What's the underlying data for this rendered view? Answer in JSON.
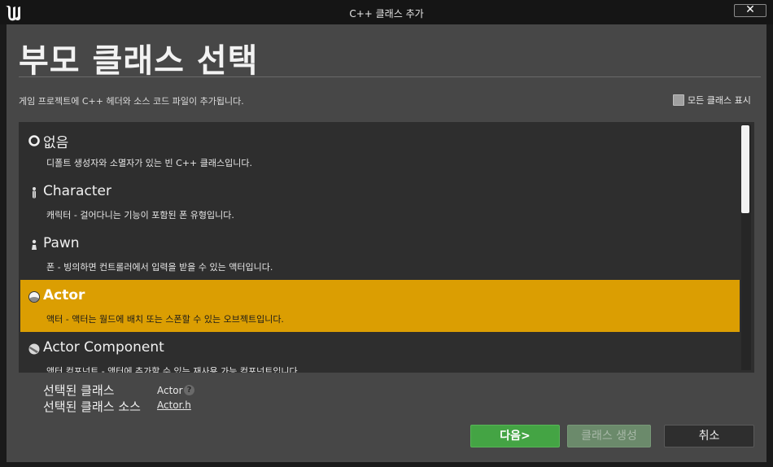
{
  "window": {
    "title": "C++ 클래스 추가",
    "close_label": "✕"
  },
  "header": {
    "title": "부모 클래스 선택",
    "description": "게임 프로젝트에 C++ 헤더와 소스 코드 파일이 추가됩니다."
  },
  "show_all": {
    "label": "모든 클래스 표시",
    "checked": false
  },
  "class_list": {
    "items": [
      {
        "name": "없음",
        "description": "디폴트 생성자와 소멸자가 있는 빈 C++ 클래스입니다.",
        "icon": "circle-outline-icon",
        "selected": false
      },
      {
        "name": "Character",
        "description": "캐릭터 - 걸어다니는 기능이 포함된 폰 유형입니다.",
        "icon": "character-icon",
        "selected": false
      },
      {
        "name": "Pawn",
        "description": "폰 - 빙의하면 컨트롤러에서 입력을 받을 수 있는 액터입니다.",
        "icon": "pawn-icon",
        "selected": false
      },
      {
        "name": "Actor",
        "description": "액터 - 액터는 월드에 배치 또는 스폰할 수 있는 오브젝트입니다.",
        "icon": "actor-sphere-icon",
        "selected": true
      },
      {
        "name": "Actor Component",
        "description": "액터 컴포넌트 - 액터에 추가할 수 있는 재사용 가능 컴포넌트입니다.",
        "icon": "component-icon",
        "selected": false
      }
    ]
  },
  "selection": {
    "class_label": "선택된 클래스",
    "class_value": "Actor",
    "source_label": "선택된 클래스 소스",
    "source_value": "Actor.h",
    "help_icon": "?"
  },
  "buttons": {
    "next_label": "다음>",
    "create_label": "클래스 생성",
    "cancel_label": "취소"
  },
  "colors": {
    "selected_row": "#db9e02",
    "next_button": "#44a444",
    "create_button_disabled": "#6b8a6b"
  }
}
